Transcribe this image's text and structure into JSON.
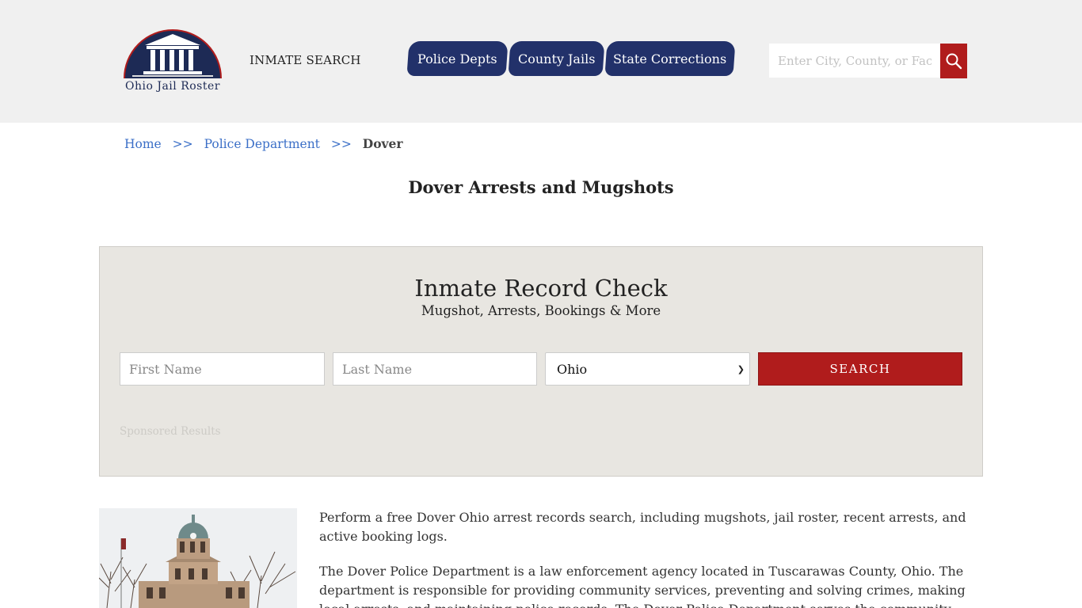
{
  "header": {
    "logo_text": "Ohio Jail Roster",
    "inmate_search_label": "INMATE SEARCH",
    "nav_tabs": [
      {
        "label": "Police Depts"
      },
      {
        "label": "County Jails"
      },
      {
        "label": "State Corrections"
      }
    ],
    "search_placeholder": "Enter City, County, or Facility",
    "search_icon": "magnifier-icon"
  },
  "breadcrumb": {
    "home": "Home",
    "separator": ">>",
    "section": "Police Department",
    "current": "Dover"
  },
  "page_title": "Dover Arrests and Mugshots",
  "record_check": {
    "title": "Inmate Record Check",
    "subtitle": "Mugshot, Arrests, Bookings & More",
    "first_name_placeholder": "First Name",
    "last_name_placeholder": "Last Name",
    "state_selected": "Ohio",
    "search_button": "SEARCH",
    "sponsored": "Sponsored Results"
  },
  "content": {
    "paragraph1": "Perform a free Dover Ohio arrest records search, including mugshots, jail roster, recent arrests, and active booking logs.",
    "paragraph2": "The Dover Police Department is a law enforcement agency located in Tuscarawas County, Ohio. The department is responsible for providing community services, preventing and solving crimes, making local arrests, and maintaining police records. The Dover Police Department serves the community by providing"
  },
  "colors": {
    "header_bg": "#f0f0f0",
    "nav_bg": "#22316a",
    "accent_red": "#b01c1c",
    "panel_bg": "#e8e6e1",
    "link_blue": "#3b6fc7"
  }
}
